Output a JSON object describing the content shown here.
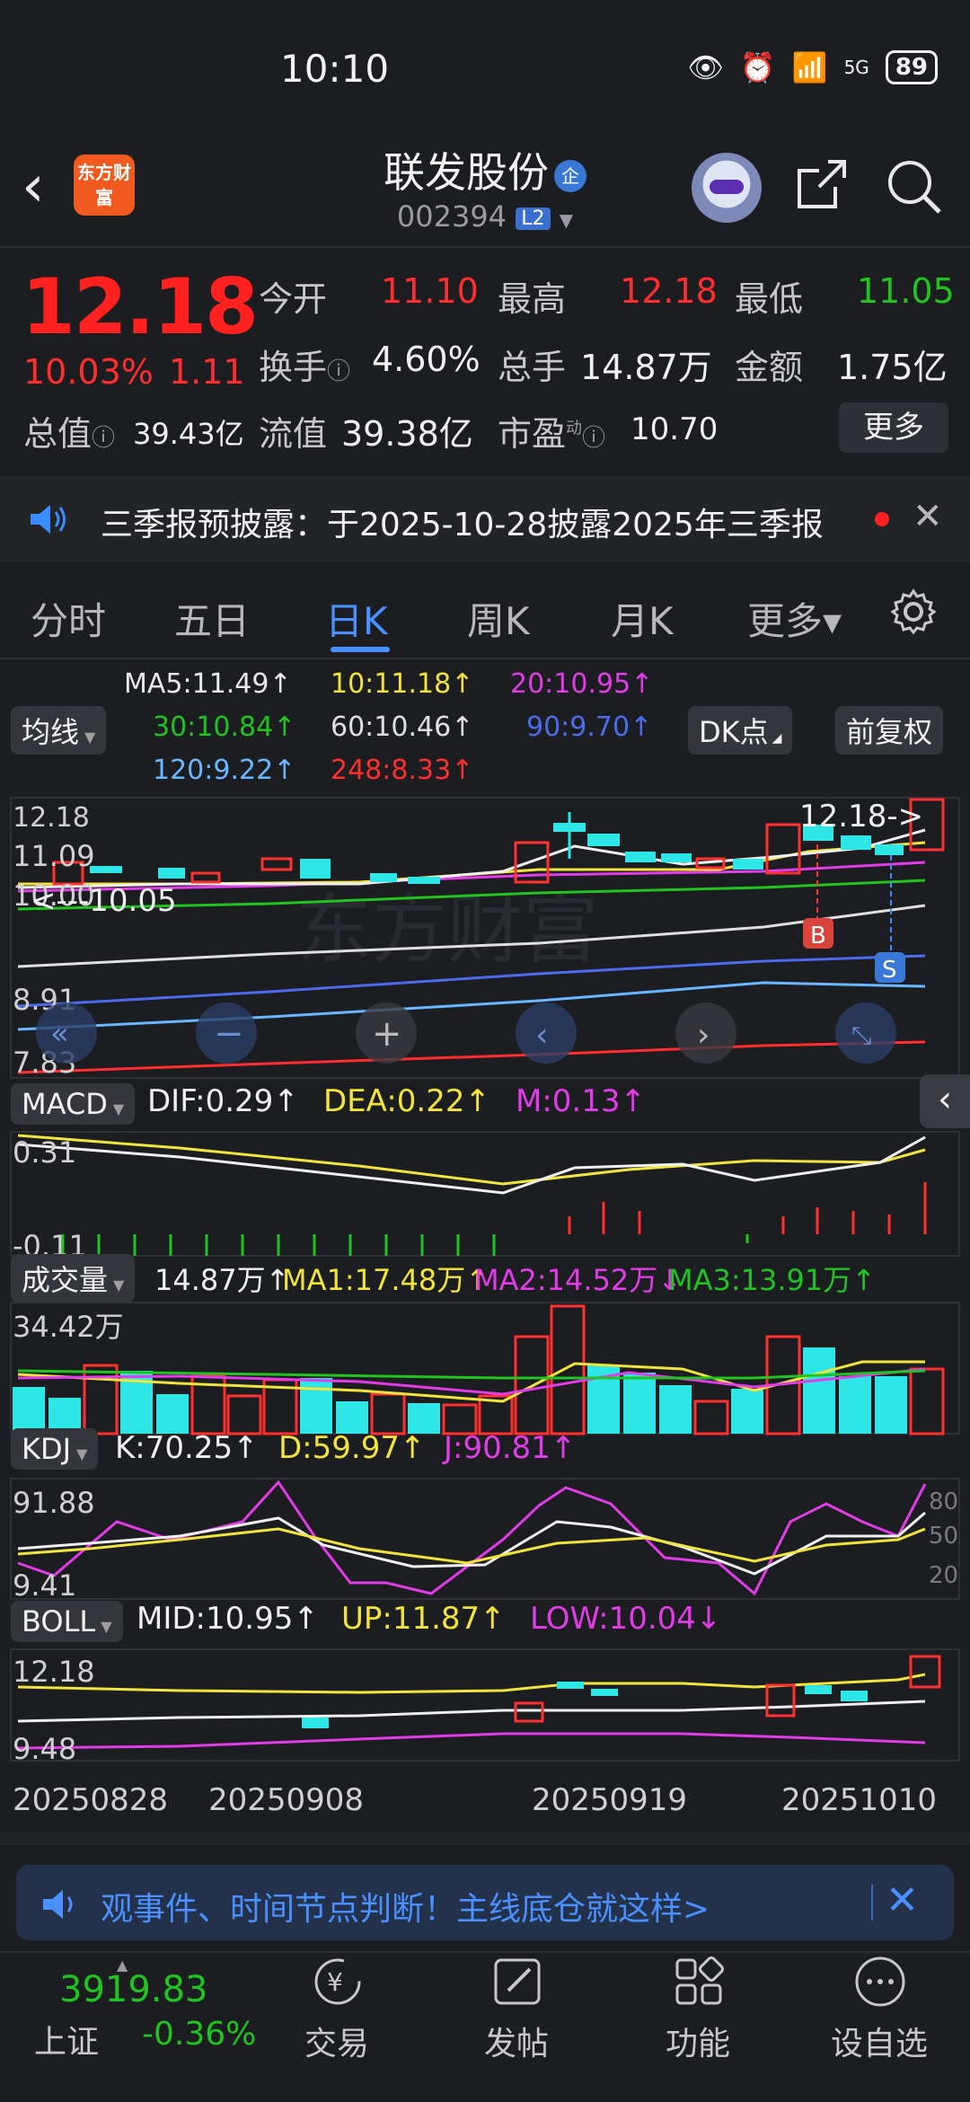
{
  "status": {
    "time": "10:10",
    "battery": "89",
    "signal": "5G"
  },
  "header": {
    "name": "联发股份",
    "badge": "企",
    "code": "002394",
    "level": "L2",
    "logo_text": "东方财富"
  },
  "quote": {
    "price": "12.18",
    "pct": "10.03%",
    "change": "1.11",
    "open_label": "今开",
    "open": "11.10",
    "high_label": "最高",
    "high": "12.18",
    "low_label": "最低",
    "low": "11.05",
    "turnover_label": "换手",
    "turnover": "4.60%",
    "volume_label": "总手",
    "volume": "14.87万",
    "amount_label": "金额",
    "amount": "1.75亿",
    "mktcap_label": "总值",
    "mktcap": "39.43亿",
    "float_label": "流值",
    "float": "39.38亿",
    "pe_label": "市盈",
    "pe_sup": "动",
    "pe": "10.70",
    "more": "更多"
  },
  "announce": {
    "text": "三季报预披露：于2025-10-28披露2025年三季报"
  },
  "tabs": [
    "分时",
    "五日",
    "日K",
    "周K",
    "月K",
    "更多▾"
  ],
  "ma": {
    "selector": "均线",
    "dk": "DK点",
    "adjust": "前复权",
    "items": [
      {
        "text": "MA5:11.49↑",
        "color": "#f0f0f0"
      },
      {
        "text": "10:11.18↑",
        "color": "#f2e43a"
      },
      {
        "text": "20:10.95↑",
        "color": "#e23ce8"
      },
      {
        "text": "30:10.84↑",
        "color": "#21c321"
      },
      {
        "text": "60:10.46↑",
        "color": "#e0e0e0"
      },
      {
        "text": "90:9.70↑",
        "color": "#4c6cf0"
      },
      {
        "text": "120:9.22↑",
        "color": "#6ab7ff"
      },
      {
        "text": "248:8.33↑",
        "color": "#ff2d2d"
      }
    ]
  },
  "kline": {
    "y_labels": [
      "12.18",
      "11.09",
      "10.00",
      "8.91",
      "7.83"
    ],
    "high_marker": "12.18->",
    "low_marker": "<---10.05",
    "buy": "B",
    "sell": "S",
    "watermark": "东方财富"
  },
  "macd": {
    "name": "MACD",
    "dif": "DIF:0.29↑",
    "dea": "DEA:0.22↑",
    "m": "M:0.13↑",
    "y_top": "0.31",
    "y_bottom": "-0.11"
  },
  "vol": {
    "name": "成交量",
    "v": "14.87万↑",
    "ma1": "MA1:17.48万↑",
    "ma2": "MA2:14.52万↓",
    "ma3": "MA3:13.91万↑",
    "y_top": "34.42万"
  },
  "kdj": {
    "name": "KDJ",
    "k": "K:70.25↑",
    "d": "D:59.97↑",
    "j": "J:90.81↑",
    "y_top": "91.88",
    "y_bottom": "9.41",
    "r80": "80",
    "r50": "50",
    "r20": "20"
  },
  "boll": {
    "name": "BOLL",
    "mid": "MID:10.95↑",
    "up": "UP:11.87↑",
    "low": "LOW:10.04↓",
    "y_top": "12.18",
    "y_bottom": "9.48"
  },
  "dates": [
    "20250828",
    "20250908",
    "20250919",
    "20251010"
  ],
  "ad": {
    "text": "观事件、时间节点判断！主线底仓就这样>"
  },
  "bottom": {
    "index_value": "3919.83",
    "index_name": "上证",
    "index_pct": "-0.36%",
    "items": [
      "交易",
      "发帖",
      "功能",
      "设自选"
    ]
  }
}
